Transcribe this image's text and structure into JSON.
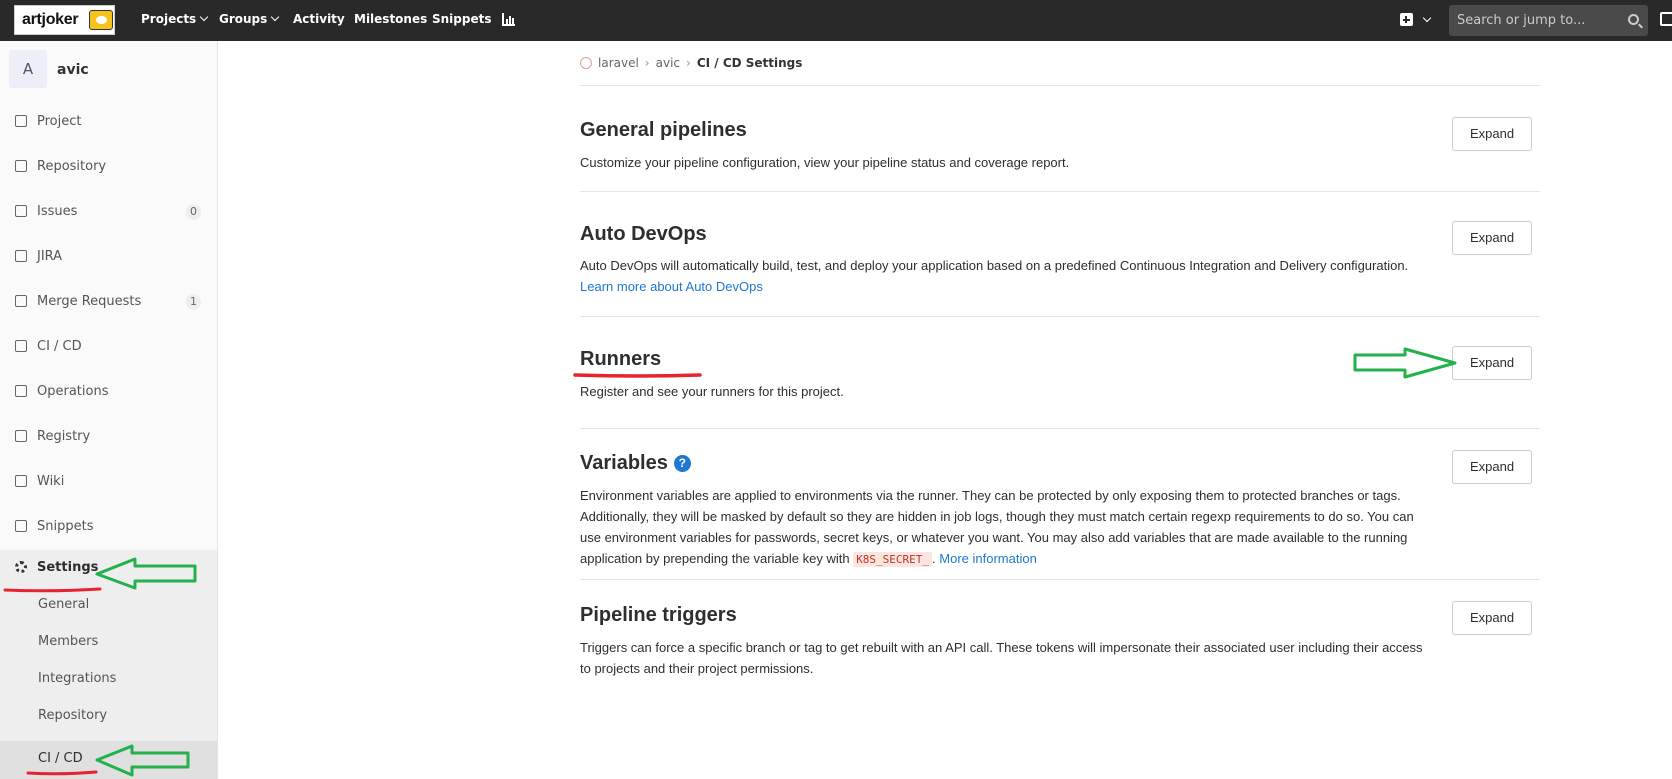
{
  "brand": {
    "logo_text": "artjoker"
  },
  "topnav": {
    "items": [
      "Projects",
      "Groups",
      "Activity",
      "Milestones",
      "Snippets"
    ],
    "search_placeholder": "Search or jump to..."
  },
  "sidebar": {
    "project_initial": "A",
    "project_name": "avic",
    "items": [
      {
        "label": "Project",
        "icon": "home-icon"
      },
      {
        "label": "Repository",
        "icon": "doc-icon"
      },
      {
        "label": "Issues",
        "icon": "issues-icon",
        "badge": "0"
      },
      {
        "label": "JIRA",
        "icon": "jira-icon"
      },
      {
        "label": "Merge Requests",
        "icon": "merge-icon",
        "badge": "1"
      },
      {
        "label": "CI / CD",
        "icon": "rocket-icon"
      },
      {
        "label": "Operations",
        "icon": "cloud-icon"
      },
      {
        "label": "Registry",
        "icon": "container-icon"
      },
      {
        "label": "Wiki",
        "icon": "book-icon"
      },
      {
        "label": "Snippets",
        "icon": "scissors-icon"
      },
      {
        "label": "Settings",
        "icon": "gear-icon"
      }
    ],
    "settings_sub": [
      "General",
      "Members",
      "Integrations",
      "Repository",
      "CI / CD"
    ]
  },
  "breadcrumb": {
    "items": [
      "laravel",
      "avic",
      "CI / CD Settings"
    ]
  },
  "sections": [
    {
      "title": "General pipelines",
      "desc": "Customize your pipeline configuration, view your pipeline status and coverage report.",
      "button": "Expand"
    },
    {
      "title": "Auto DevOps",
      "desc": "Auto DevOps will automatically build, test, and deploy your application based on a predefined Continuous Integration and Delivery configuration.",
      "link": "Learn more about Auto DevOps",
      "button": "Expand"
    },
    {
      "title": "Runners",
      "desc": "Register and see your runners for this project.",
      "button": "Expand"
    },
    {
      "title": "Variables",
      "desc": "Environment variables are applied to environments via the runner. They can be protected by only exposing them to protected branches or tags. Additionally, they will be masked by default so they are hidden in job logs, though they must match certain regexp requirements to do so. You can use environment variables for passwords, secret keys, or whatever you want. You may also add variables that are made available to the running application by prepending the variable key with",
      "code": "K8S_SECRET_",
      "link": "More information",
      "button": "Expand"
    },
    {
      "title": "Pipeline triggers",
      "desc": "Triggers can force a specific branch or tag to get rebuilt with an API call. These tokens will impersonate their associated user including their access to projects and their project permissions.",
      "button": "Expand"
    }
  ],
  "colors": {
    "annotation_red": "#e8222e",
    "annotation_green": "#22b14c",
    "link": "#1f78d1",
    "topbar": "#292929"
  }
}
